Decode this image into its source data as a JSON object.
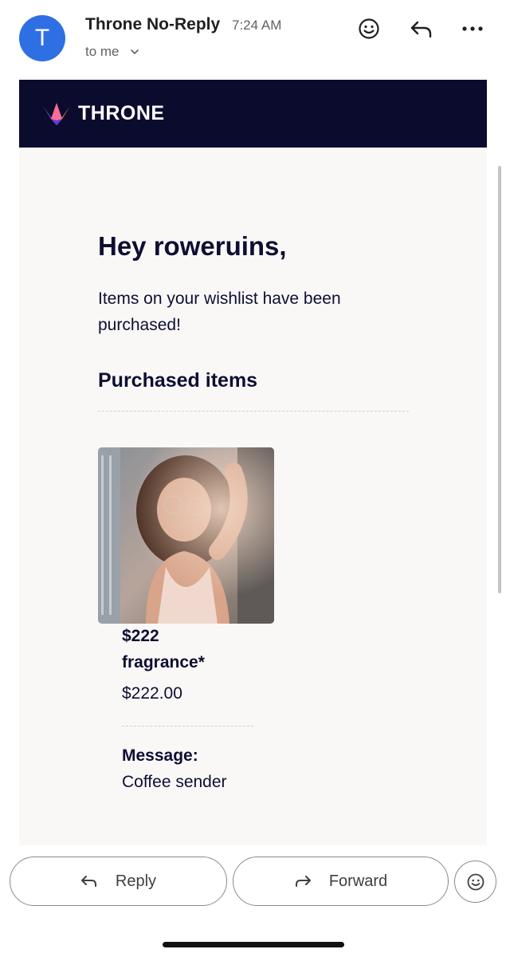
{
  "email": {
    "sender_initial": "T",
    "sender_name": "Throne No-Reply",
    "time": "7:24 AM",
    "recipient": "to me"
  },
  "icons": {
    "react": "smiley-icon",
    "reply": "reply-arrow-icon",
    "more": "more-dots-icon",
    "recipient_toggle": "chevron-down-icon",
    "forward": "forward-arrow-icon"
  },
  "brand": {
    "name": "THRONE",
    "bar_color": "#0b0b2e"
  },
  "content": {
    "greeting": "Hey roweruins,",
    "intro": "Items on your wishlist have been purchased!",
    "section_title": "Purchased items",
    "item": {
      "price_title": "$222",
      "name": "fragrance*",
      "price": "$222.00"
    },
    "message_label": "Message:",
    "message_text": "Coffee sender"
  },
  "actions": {
    "reply_label": "Reply",
    "forward_label": "Forward"
  },
  "colors": {
    "avatar": "#2f6fe4",
    "text_dark": "#0e0e33",
    "body_bg": "#faf8f7"
  }
}
